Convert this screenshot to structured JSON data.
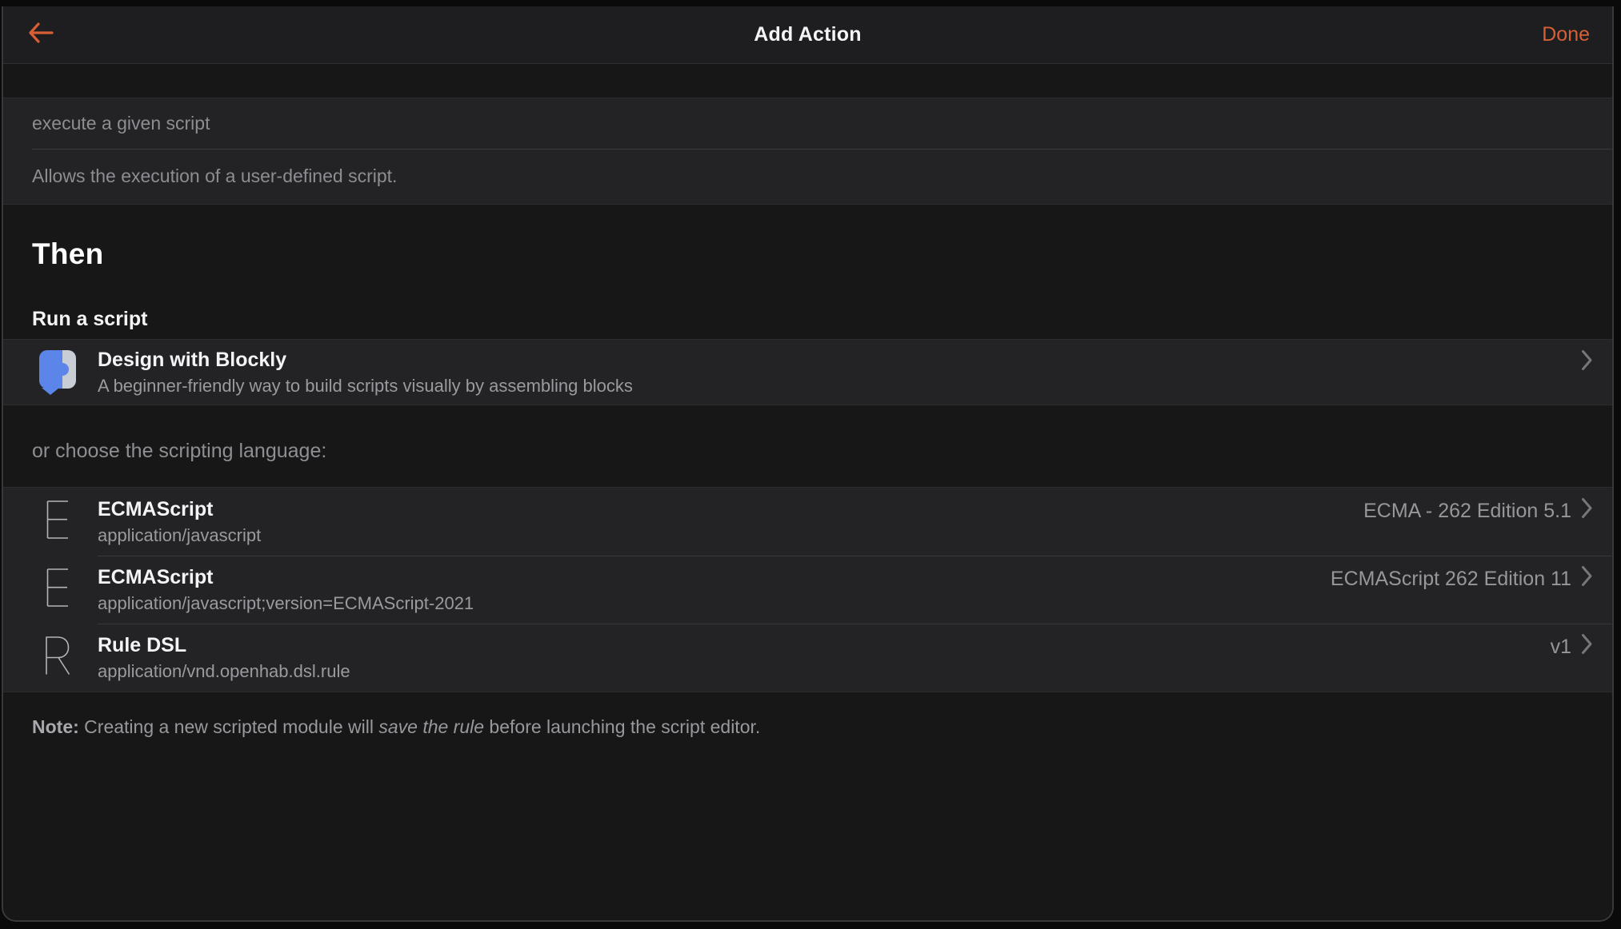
{
  "navbar": {
    "title": "Add Action",
    "done_label": "Done"
  },
  "intro": {
    "name": "execute a given script",
    "description": "Allows the execution of a user-defined script."
  },
  "then_heading": "Then",
  "run_script_heading": "Run a script",
  "blockly": {
    "title": "Design with Blockly",
    "subtitle": "A beginner-friendly way to build scripts visually by assembling blocks"
  },
  "choose_language_label": "or choose the scripting language:",
  "languages": [
    {
      "icon": "E",
      "title": "ECMAScript",
      "subtitle": "application/javascript",
      "version": "ECMA - 262 Edition 5.1"
    },
    {
      "icon": "E",
      "title": "ECMAScript",
      "subtitle": "application/javascript;version=ECMAScript-2021",
      "version": "ECMAScript 262 Edition 11"
    },
    {
      "icon": "R",
      "title": "Rule DSL",
      "subtitle": "application/vnd.openhab.dsl.rule",
      "version": "v1"
    }
  ],
  "note": {
    "prefix": "Note:",
    "text_before_italic": " Creating a new scripted module will ",
    "italic": "save the rule",
    "text_after_italic": " before launching the script editor."
  },
  "colors": {
    "accent_orange": "#d75f35",
    "blockly_blue": "#5b85e8",
    "blockly_light": "#c9cdd6",
    "row_background": "#232325",
    "page_background": "#171717"
  }
}
